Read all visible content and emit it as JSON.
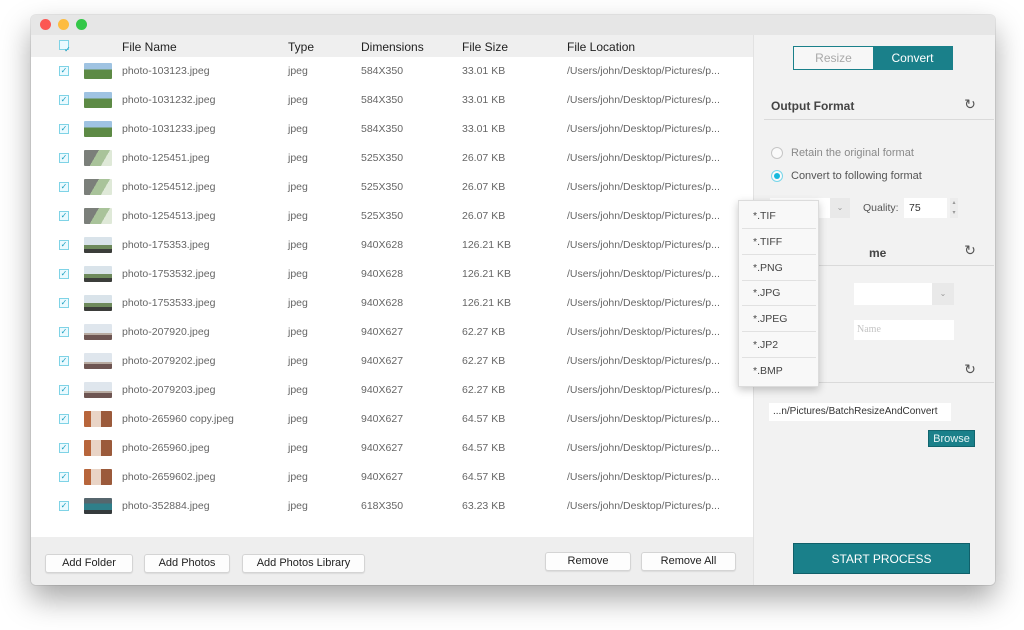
{
  "window": {
    "traffic_lights": [
      "close",
      "minimize",
      "zoom"
    ]
  },
  "list": {
    "select_all_checked": true,
    "columns": [
      "File Name",
      "Type",
      "Dimensions",
      "File Size",
      "File Location"
    ],
    "rows": [
      {
        "checked": true,
        "thumb": "t-a",
        "name": "photo-103123.jpeg",
        "type": "jpeg",
        "dimensions": "584X350",
        "size": "33.01 KB",
        "location": "/Users/john/Desktop/Pictures/p..."
      },
      {
        "checked": true,
        "thumb": "t-a",
        "name": "photo-1031232.jpeg",
        "type": "jpeg",
        "dimensions": "584X350",
        "size": "33.01 KB",
        "location": "/Users/john/Desktop/Pictures/p..."
      },
      {
        "checked": true,
        "thumb": "t-a",
        "name": "photo-1031233.jpeg",
        "type": "jpeg",
        "dimensions": "584X350",
        "size": "33.01 KB",
        "location": "/Users/john/Desktop/Pictures/p..."
      },
      {
        "checked": true,
        "thumb": "t-b",
        "name": "photo-125451.jpeg",
        "type": "jpeg",
        "dimensions": "525X350",
        "size": "26.07 KB",
        "location": "/Users/john/Desktop/Pictures/p..."
      },
      {
        "checked": true,
        "thumb": "t-b",
        "name": "photo-1254512.jpeg",
        "type": "jpeg",
        "dimensions": "525X350",
        "size": "26.07 KB",
        "location": "/Users/john/Desktop/Pictures/p..."
      },
      {
        "checked": true,
        "thumb": "t-b",
        "name": "photo-1254513.jpeg",
        "type": "jpeg",
        "dimensions": "525X350",
        "size": "26.07 KB",
        "location": "/Users/john/Desktop/Pictures/p..."
      },
      {
        "checked": true,
        "thumb": "t-c",
        "name": "photo-175353.jpeg",
        "type": "jpeg",
        "dimensions": "940X628",
        "size": "126.21 KB",
        "location": "/Users/john/Desktop/Pictures/p..."
      },
      {
        "checked": true,
        "thumb": "t-c",
        "name": "photo-1753532.jpeg",
        "type": "jpeg",
        "dimensions": "940X628",
        "size": "126.21 KB",
        "location": "/Users/john/Desktop/Pictures/p..."
      },
      {
        "checked": true,
        "thumb": "t-c",
        "name": "photo-1753533.jpeg",
        "type": "jpeg",
        "dimensions": "940X628",
        "size": "126.21 KB",
        "location": "/Users/john/Desktop/Pictures/p..."
      },
      {
        "checked": true,
        "thumb": "t-d",
        "name": "photo-207920.jpeg",
        "type": "jpeg",
        "dimensions": "940X627",
        "size": "62.27 KB",
        "location": "/Users/john/Desktop/Pictures/p..."
      },
      {
        "checked": true,
        "thumb": "t-d",
        "name": "photo-2079202.jpeg",
        "type": "jpeg",
        "dimensions": "940X627",
        "size": "62.27 KB",
        "location": "/Users/john/Desktop/Pictures/p..."
      },
      {
        "checked": true,
        "thumb": "t-d",
        "name": "photo-2079203.jpeg",
        "type": "jpeg",
        "dimensions": "940X627",
        "size": "62.27 KB",
        "location": "/Users/john/Desktop/Pictures/p..."
      },
      {
        "checked": true,
        "thumb": "t-e",
        "name": "photo-265960 copy.jpeg",
        "type": "jpeg",
        "dimensions": "940X627",
        "size": "64.57 KB",
        "location": "/Users/john/Desktop/Pictures/p..."
      },
      {
        "checked": true,
        "thumb": "t-e",
        "name": "photo-265960.jpeg",
        "type": "jpeg",
        "dimensions": "940X627",
        "size": "64.57 KB",
        "location": "/Users/john/Desktop/Pictures/p..."
      },
      {
        "checked": true,
        "thumb": "t-e",
        "name": "photo-2659602.jpeg",
        "type": "jpeg",
        "dimensions": "940X627",
        "size": "64.57 KB",
        "location": "/Users/john/Desktop/Pictures/p..."
      },
      {
        "checked": true,
        "thumb": "t-f",
        "name": "photo-352884.jpeg",
        "type": "jpeg",
        "dimensions": "618X350",
        "size": "63.23 KB",
        "location": "/Users/john/Desktop/Pictures/p..."
      }
    ]
  },
  "bottom_bar": {
    "add_folder": "Add Folder",
    "add_photos": "Add Photos",
    "add_photos_library": "Add Photos Library",
    "remove": "Remove",
    "remove_all": "Remove All"
  },
  "side": {
    "tabs": [
      {
        "label": "Resize",
        "active": false
      },
      {
        "label": "Convert",
        "active": true
      }
    ],
    "output_format": {
      "title": "Output Format",
      "retain_label": "Retain the original format",
      "convert_label": "Convert to  following format",
      "selected_option": "convert",
      "format_value": "*.JPG",
      "quality_label": "Quality:",
      "quality_value": "75"
    },
    "rename": {
      "title_visible_fragment": "me",
      "name_placeholder": "Name"
    },
    "output_path": {
      "value": "...n/Pictures/BatchResizeAndConvert",
      "browse": "Browse"
    },
    "start": "START PROCESS"
  },
  "format_dropdown": {
    "options": [
      "*.TIF",
      "*.TIFF",
      "*.PNG",
      "*.JPG",
      "*.JPEG",
      "*.JP2",
      "*.BMP"
    ]
  },
  "colors": {
    "accent": "#1a808a",
    "radio_selected": "#16b9dd",
    "checkbox_border": "#7fd3e6"
  },
  "icons": {
    "refresh": "↻",
    "chevron_down": "⌄",
    "check": "✓",
    "stepper_up": "▴",
    "stepper_down": "▾"
  }
}
